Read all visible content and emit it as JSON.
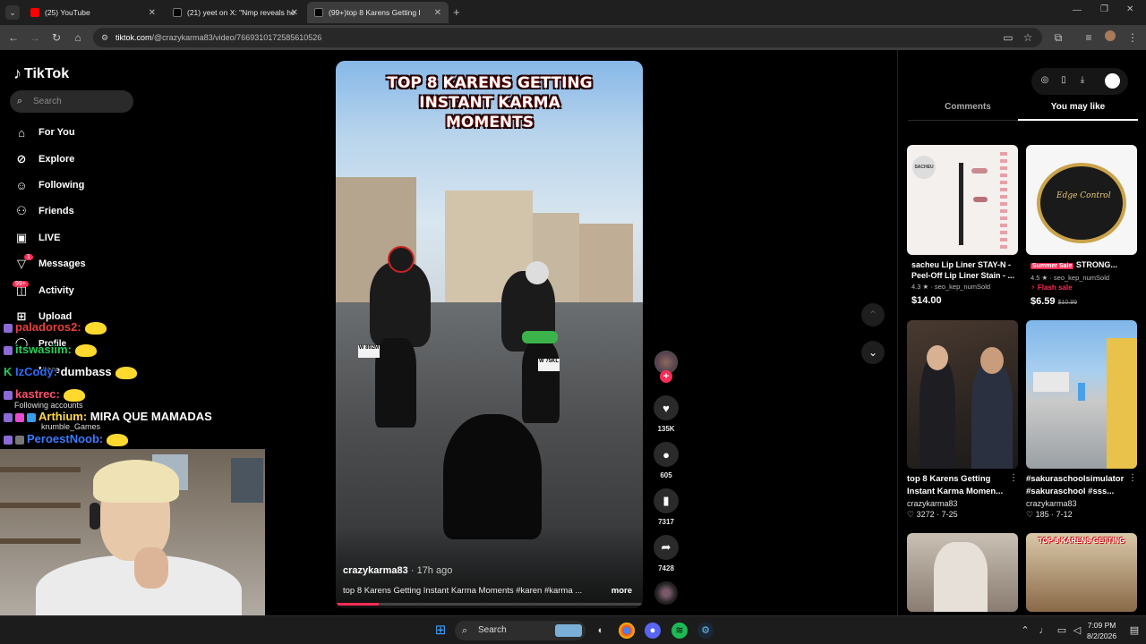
{
  "browser": {
    "tabs": [
      {
        "label": "(25) YouTube",
        "color": "#ff0000"
      },
      {
        "label": "(21) yeet on X: \"Nmp reveals he",
        "color": "#000000"
      },
      {
        "label": "(99+)top 8 Karens Getting I",
        "color": "#000000"
      }
    ],
    "new_tab_icon": "plus",
    "url_host": "tiktok.com",
    "url_path": "/@crazykarma83/video/7669310172585610526"
  },
  "sidebar": {
    "logo": "TikTok",
    "search_placeholder": "Search",
    "items": [
      {
        "label": "For You",
        "icon": "home-icon"
      },
      {
        "label": "Explore",
        "icon": "compass-icon"
      },
      {
        "label": "Following",
        "icon": "following-icon"
      },
      {
        "label": "Friends",
        "icon": "friends-icon"
      },
      {
        "label": "LIVE",
        "icon": "live-icon"
      },
      {
        "label": "Messages",
        "icon": "messages-icon",
        "badge": "1"
      },
      {
        "label": "Activity",
        "icon": "activity-icon",
        "badge": "99+"
      },
      {
        "label": "Upload",
        "icon": "upload-icon"
      },
      {
        "label": "Profile",
        "icon": "profile-icon"
      },
      {
        "label": "More",
        "icon": "more-icon"
      }
    ],
    "following_accounts_label": "Following accounts",
    "following_account": "krumble_Games"
  },
  "chat": [
    {
      "user": "paladoros2:",
      "color": "#e8413b"
    },
    {
      "user": "itswasiim:",
      "color": "#23d05a"
    },
    {
      "user": "IzCody:",
      "color": "#2f6bff",
      "message": "dumbass"
    },
    {
      "user": "kastrec:",
      "color": "#ff4f6d"
    },
    {
      "user": "Arthium:",
      "color": "#ffd94a",
      "message": "MIRA QUE MAMADAS"
    },
    {
      "user": "PeroestNoob:",
      "color": "#3a7bff"
    }
  ],
  "video": {
    "overlay_title_line1": "TOP 8 KARENS GETTING",
    "overlay_title_line2": "INSTANT KARMA MOMENTS",
    "plate1": "W 892M",
    "plate2": "W 75KL",
    "author": "crazykarma83",
    "ago": " · 17h ago",
    "caption": "top 8 Karens Getting Instant Karma Moments #karen #karma ...",
    "more": "more",
    "progress": 0.14,
    "likes": "135K",
    "comments": "605",
    "saves": "7317",
    "shares": "7428"
  },
  "right_panel": {
    "tab_comments": "Comments",
    "tab_you_may_like": "You may like",
    "products": [
      {
        "title": "sacheu Lip Liner STAY-N - Peel-Off Lip Liner Stain - ...",
        "rating": "4.3 ★ · seo_kep_numSold",
        "price": "$14.00",
        "img_text": "SACHEU"
      },
      {
        "sale_tag": "Summer Sale",
        "title": "STRONG...",
        "rating": "4.5 ★ · seo_kep_numSold",
        "flash": "⚡ Flash sale",
        "price": "$6.59",
        "old_price": "$10.99",
        "img_text": "Edge Control"
      }
    ],
    "videos": [
      {
        "title": "top 8 Karens Getting Instant Karma Momen...",
        "author": "crazykarma83",
        "likes": "♡ 3272 · 7-25"
      },
      {
        "title": "#sakuraschoolsimulator #sakuraschool #sss...",
        "author": "crazykarma83",
        "likes": "♡ 185 · 7-12"
      }
    ],
    "thumb_text": "TOP 8 KARENS GETTING"
  },
  "taskbar": {
    "search": "Search",
    "time": "7:09 PM",
    "date": "8/2/2026"
  }
}
